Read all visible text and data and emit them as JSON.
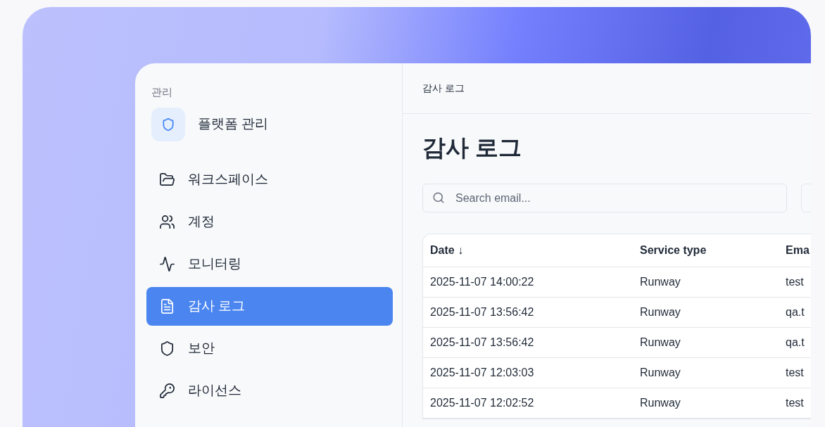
{
  "sidebar": {
    "section_label": "관리",
    "header": {
      "title": "플랫폼 관리"
    },
    "items": [
      {
        "label": "워크스페이스",
        "kind": "folder",
        "selected": false
      },
      {
        "label": "계정",
        "kind": "users",
        "selected": false
      },
      {
        "label": "모니터링",
        "kind": "activity",
        "selected": false
      },
      {
        "label": "감사 로그",
        "kind": "document",
        "selected": true
      },
      {
        "label": "보안",
        "kind": "shield",
        "selected": false
      },
      {
        "label": "라이선스",
        "kind": "key",
        "selected": false
      }
    ]
  },
  "breadcrumb": "감사 로그",
  "page_title": "감사 로그",
  "search": {
    "placeholder": "Search email..."
  },
  "table": {
    "columns": [
      "Date ↓",
      "Service type",
      "Ema"
    ],
    "rows": [
      [
        "2025-11-07 14:00:22",
        "Runway",
        "test"
      ],
      [
        "2025-11-07 13:56:42",
        "Runway",
        "qa.t"
      ],
      [
        "2025-11-07 13:56:42",
        "Runway",
        "qa.t"
      ],
      [
        "2025-11-07 12:03:03",
        "Runway",
        "test"
      ],
      [
        "2025-11-07 12:02:52",
        "Runway",
        "test"
      ]
    ]
  }
}
